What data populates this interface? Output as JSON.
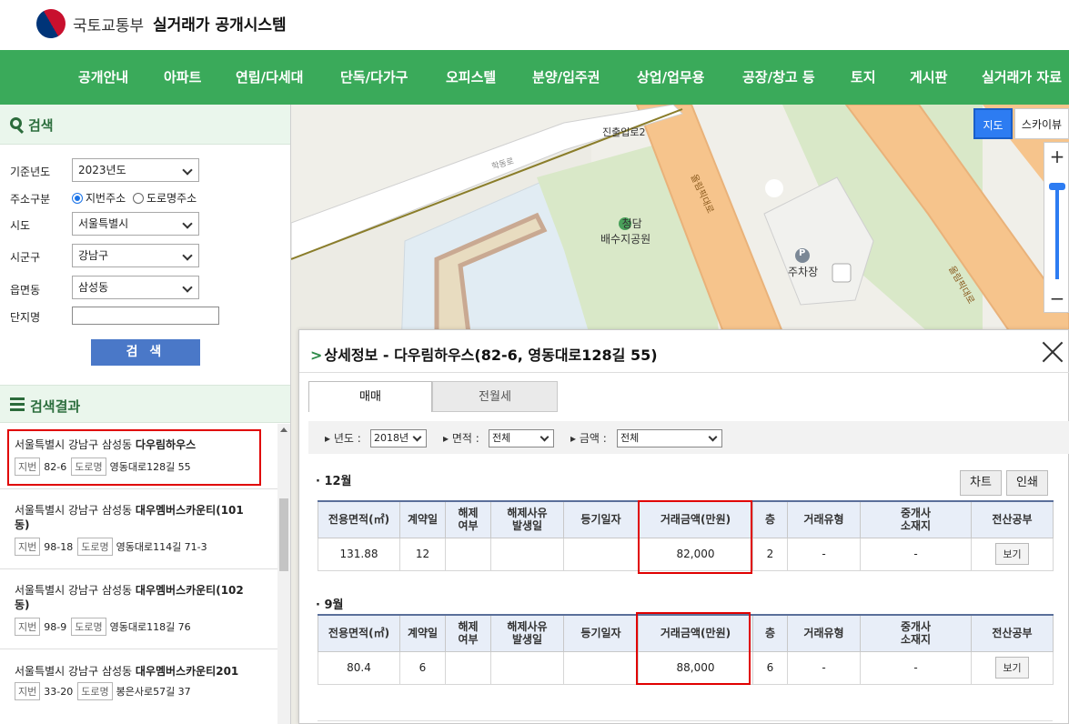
{
  "header": {
    "org_name": "국토교통부",
    "system_name": "실거래가 공개시스템"
  },
  "nav": {
    "items": [
      "공개안내",
      "아파트",
      "연립/다세대",
      "단독/다가구",
      "오피스텔",
      "분양/입주권",
      "상업/업무용",
      "공장/창고 등",
      "토지",
      "게시판",
      "실거래가 자료"
    ]
  },
  "search": {
    "title": "검색",
    "year_label": "기준년도",
    "year_value": "2023년도",
    "addr_type_label": "주소구분",
    "addr_opt1": "지번주소",
    "addr_opt2": "도로명주소",
    "sido_label": "시도",
    "sido_value": "서울특별시",
    "sigungu_label": "시군구",
    "sigungu_value": "강남구",
    "dong_label": "읍면동",
    "dong_value": "삼성동",
    "complex_label": "단지명",
    "complex_value": "",
    "button": "검 색"
  },
  "results": {
    "title": "검색결과",
    "jibun_tag": "지번",
    "road_tag": "도로명",
    "items": [
      {
        "region": "서울특별시 강남구 삼성동",
        "name": "다우림하우스",
        "jibun": "82-6",
        "road": "영동대로128길 55"
      },
      {
        "region": "서울특별시 강남구 삼성동",
        "name": "대우멤버스카운티(101동)",
        "name_line1": "대우멤버스카운티(101",
        "name_line2": "동)",
        "jibun": "98-18",
        "road": "영동대로114길 71-3"
      },
      {
        "region": "서울특별시 강남구 삼성동",
        "name": "대우멤버스카운티(102동)",
        "name_line1": "대우멤버스카운티(102",
        "name_line2": "동)",
        "jibun": "98-9",
        "road": "영동대로118길 76"
      },
      {
        "region": "서울특별시 강남구 삼성동",
        "name": "대우멤버스카운티201",
        "jibun": "33-20",
        "road": "봉은사로57길 37"
      }
    ]
  },
  "map": {
    "type_map": "지도",
    "type_sky": "스카이뷰",
    "zoom_in": "+",
    "zoom_out": "−",
    "labels": {
      "road1": "진출입로2",
      "road2": "올림픽대로",
      "road3": "올림픽대로",
      "park_line1": "청담",
      "park_line2": "배수지공원",
      "parking": "주차장",
      "parking_mark": "P",
      "small_road": "학동로"
    }
  },
  "detail": {
    "title_prefix": "상세정보 - ",
    "title": "다우림하우스(82-6, 영동대로128길 55)",
    "tab_sale": "매매",
    "tab_rent": "전월세",
    "filter_year_label": "년도 :",
    "filter_year_value": "2018년",
    "filter_area_label": "면적 :",
    "filter_area_value": "전체",
    "filter_price_label": "금액 :",
    "filter_price_value": "전체",
    "chart_btn": "차트",
    "print_btn": "인쇄",
    "columns": [
      "전용면적(㎡)",
      "계약일",
      "해제\n여부",
      "해제사유\n발생일",
      "등기일자",
      "거래금액(만원)",
      "층",
      "거래유형",
      "중개사\n소재지",
      "전산공부"
    ],
    "months": [
      {
        "label": "12월",
        "row": {
          "area": "131.88",
          "day": "12",
          "cancel": "",
          "cancel_date": "",
          "reg_date": "",
          "price": "82,000",
          "floor": "2",
          "deal_type": "-",
          "agent": "-",
          "doc": "보기"
        }
      },
      {
        "label": "9월",
        "row": {
          "area": "80.4",
          "day": "6",
          "cancel": "",
          "cancel_date": "",
          "reg_date": "",
          "price": "88,000",
          "floor": "6",
          "deal_type": "-",
          "agent": "-",
          "doc": "보기"
        }
      }
    ]
  }
}
